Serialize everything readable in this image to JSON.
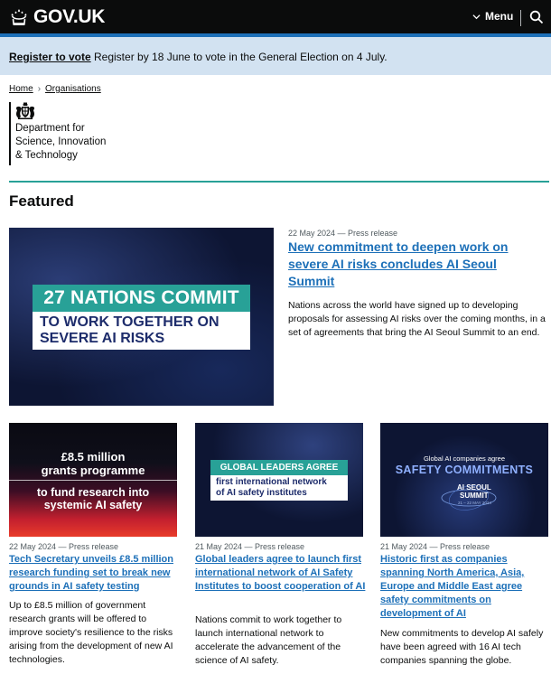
{
  "header": {
    "logo_text": "GOV.UK",
    "menu_label": "Menu",
    "icons": {
      "logo": "crown-icon",
      "menu": "chevron-down-icon",
      "search": "search-icon"
    },
    "colors": {
      "background": "#0b0c0c",
      "accent": "#1d70b8"
    }
  },
  "banner": {
    "link_label": "Register to vote",
    "text": "Register by 18 June to vote in the General Election on 4 July.",
    "background": "#d2e2f1"
  },
  "breadcrumb": {
    "items": [
      "Home",
      "Organisations"
    ]
  },
  "organisation": {
    "crest_icon": "royal-coat-of-arms-icon",
    "name_lines": [
      "Department for",
      "Science, Innovation",
      "& Technology"
    ],
    "brand_color": "#28a197"
  },
  "featured": {
    "heading": "Featured",
    "lead": {
      "image_text_1": "27 NATIONS COMMIT",
      "image_text_2_line1": "TO WORK TOGETHER ON",
      "image_text_2_line2": "SEVERE AI RISKS",
      "meta": "22 May 2024 — Press release",
      "title": "New commitment to deepen work on severe AI risks concludes AI Seoul Summit",
      "description": "Nations across the world have signed up to developing proposals for assessing AI risks over the coming months, in a set of agreements that bring the AI Seoul Summit to an end."
    },
    "cards": [
      {
        "image_text_1_line1": "£8.5 million",
        "image_text_1_line2": "grants programme",
        "image_text_2_line1": "to fund research into",
        "image_text_2_line2": "systemic AI safety",
        "meta": "22 May 2024 — Press release",
        "title": "Tech Secretary unveils £8.5 million research funding set to break new grounds in AI safety testing",
        "description": "Up to £8.5 million of government research grants will be offered to improve society's resilience to the risks arising from the development of new AI technologies."
      },
      {
        "image_text_1": "GLOBAL LEADERS AGREE",
        "image_text_2_line1": "first international network",
        "image_text_2_line2": "of AI safety institutes",
        "meta": "21 May 2024 — Press release",
        "title": "Global leaders agree to launch first international network of AI Safety Institutes to boost cooperation of AI",
        "description": "Nations commit to work together to launch international network to accelerate the advancement of the science of AI safety."
      },
      {
        "image_text_1": "Global AI companies agree",
        "image_text_2": "SAFETY COMMITMENTS",
        "image_badge_1": "AI SEOUL",
        "image_badge_2": "SUMMIT",
        "image_badge_3": "21 – 22 MAY 2024",
        "meta": "21 May 2024 — Press release",
        "title": "Historic first as companies spanning North America, Asia, Europe and Middle East agree safety commitments on development of AI",
        "description": "New commitments to develop AI safely have been agreed with 16 AI tech companies spanning the globe."
      }
    ]
  }
}
